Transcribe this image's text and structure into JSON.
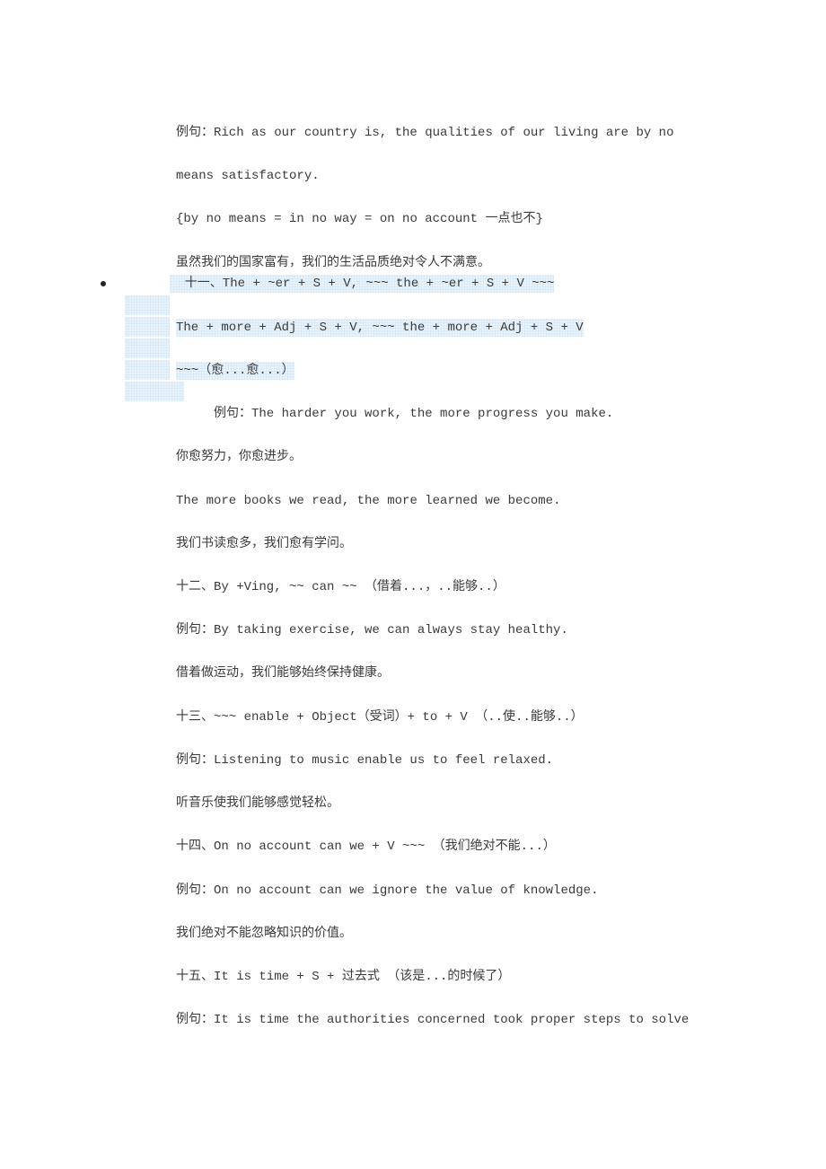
{
  "document": {
    "paragraphs": {
      "p1": "例句：Rich as our country is, the qualities of our living are by no",
      "p2": "means satisfactory.",
      "p3": "{by no means = in no way = on no account 一点也不}",
      "p4": "虽然我们的国家富有，我们的生活品质绝对令人不满意。",
      "p5": "  十一、The + ~er + S + V, ~~~ the + ~er + S + V ~~~",
      "p6": "The + more + Adj + S + V, ~~~ the + more + Adj + S + V",
      "p7": "~~~（愈...愈...）",
      "p8": "     例句：The harder you work, the more progress you make.",
      "p9": "你愈努力，你愈进步。",
      "p10": "The more books we read, the more learned we become.",
      "p11": "我们书读愈多，我们愈有学问。",
      "p12": "十二、By +Ving, ~~ can ~~ （借着...，..能够..）",
      "p13": "例句：By taking exercise, we can always stay healthy.",
      "p14": "借着做运动，我们能够始终保持健康。",
      "p15": "十三、~~~ enable + Object（受词）+ to + V （..使..能够..）",
      "p16": "例句：Listening to music enable us to feel relaxed.",
      "p17": "听音乐使我们能够感觉轻松。",
      "p18": "十四、On no account can we + V ~~~ （我们绝对不能...）",
      "p19": "例句：On no account can we ignore the value of knowledge.",
      "p20": "我们绝对不能忽略知识的价值。",
      "p21": "十五、It is time + S + 过去式 （该是...的时候了）",
      "p22": "例句：It is time the authorities concerned took proper steps to solve"
    },
    "list_bullet": "•",
    "highlight_color": "#e9f3fb"
  }
}
